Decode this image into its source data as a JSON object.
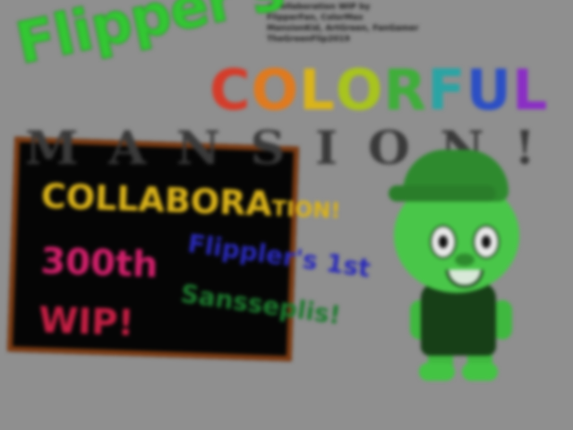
{
  "credits": [
    "A collaboration WIP by",
    "FlipperFan, ColorMax",
    "MansionKid, ArtGreen, FanGamer",
    "TheGreenFlip2019"
  ],
  "title": {
    "line1": "Flipper's",
    "line2_letters": [
      {
        "ch": "C",
        "color": "#d43c2a"
      },
      {
        "ch": "O",
        "color": "#e07a1e"
      },
      {
        "ch": "L",
        "color": "#d9b41a"
      },
      {
        "ch": "O",
        "color": "#a8c41e"
      },
      {
        "ch": "R",
        "color": "#3fae3a"
      },
      {
        "ch": "F",
        "color": "#2aa4a4"
      },
      {
        "ch": "U",
        "color": "#2c4fc4"
      },
      {
        "ch": "L",
        "color": "#8a2ec4"
      }
    ],
    "line3_letters": [
      "M",
      "A",
      "N",
      "S",
      "I",
      "O",
      "N",
      "!"
    ]
  },
  "board": {
    "line1_main": "COLLABORA",
    "line1_tail": "TION!",
    "line2": "300th",
    "line3": "WIP!"
  },
  "caption": {
    "line1": "Flippler's 1st",
    "line2": "Sansseplis!"
  },
  "colors": {
    "background": "#8f8f8f",
    "board": "#050505",
    "board_frame": "#7a3a12",
    "character_skin": "#49c649",
    "character_shirt": "#173f17"
  }
}
